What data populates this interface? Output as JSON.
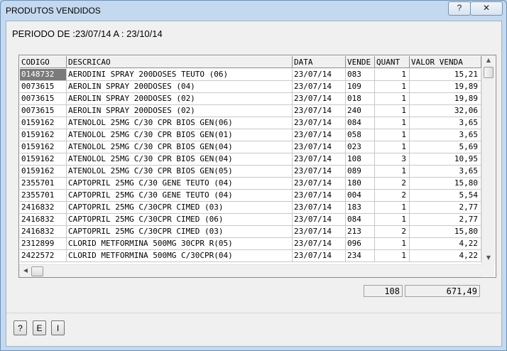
{
  "window": {
    "title": "PRODUTOS VENDIDOS",
    "help_label": "?",
    "close_label": "✕"
  },
  "period": {
    "text": "PERIODO DE :23/07/14 A : 23/10/14"
  },
  "table": {
    "columns": [
      "CODIGO",
      "DESCRICAO",
      "DATA",
      "VENDE",
      "QUANT",
      "VALOR VENDA"
    ],
    "rows": [
      [
        "0148732",
        "AERODINI SPRAY 200DOSES TEUTO   (06)",
        "23/07/14",
        "083",
        "1",
        "15,21"
      ],
      [
        "0073615",
        "AEROLIN SPRAY 200DOSES          (04)",
        "23/07/14",
        "109",
        "1",
        "19,89"
      ],
      [
        "0073615",
        "AEROLIN SPRAY 200DOSES          (02)",
        "23/07/14",
        "018",
        "1",
        "19,89"
      ],
      [
        "0073615",
        "AEROLIN SPRAY 200DOSES          (02)",
        "23/07/14",
        "240",
        "1",
        "32,06"
      ],
      [
        "0159162",
        "ATENOLOL 25MG C/30 CPR BIOS GEN(06)",
        "23/07/14",
        "084",
        "1",
        "3,65"
      ],
      [
        "0159162",
        "ATENOLOL 25MG C/30 CPR BIOS GEN(01)",
        "23/07/14",
        "058",
        "1",
        "3,65"
      ],
      [
        "0159162",
        "ATENOLOL 25MG C/30 CPR BIOS GEN(04)",
        "23/07/14",
        "023",
        "1",
        "5,69"
      ],
      [
        "0159162",
        "ATENOLOL 25MG C/30 CPR BIOS GEN(04)",
        "23/07/14",
        "108",
        "3",
        "10,95"
      ],
      [
        "0159162",
        "ATENOLOL 25MG C/30 CPR BIOS GEN(05)",
        "23/07/14",
        "089",
        "1",
        "3,65"
      ],
      [
        "2355701",
        "CAPTOPRIL 25MG C/30 GENE TEUTO (04)",
        "23/07/14",
        "180",
        "2",
        "15,80"
      ],
      [
        "2355701",
        "CAPTOPRIL 25MG C/30 GENE TEUTO (04)",
        "23/07/14",
        "004",
        "2",
        "5,54"
      ],
      [
        "2416832",
        "CAPTOPRIL 25MG C/30CPR CIMED   (03)",
        "23/07/14",
        "183",
        "1",
        "2,77"
      ],
      [
        "2416832",
        "CAPTOPRIL 25MG C/30CPR CIMED   (06)",
        "23/07/14",
        "084",
        "1",
        "2,77"
      ],
      [
        "2416832",
        "CAPTOPRIL 25MG C/30CPR CIMED   (03)",
        "23/07/14",
        "213",
        "2",
        "15,80"
      ],
      [
        "2312899",
        "CLORID METFORMINA 500MG 30CPR R(05)",
        "23/07/14",
        "096",
        "1",
        "4,22"
      ],
      [
        "2422572",
        "CLORID METFORMINA 500MG C/30CPR(04)",
        "23/07/14",
        "234",
        "1",
        "4,22"
      ]
    ]
  },
  "totals": {
    "quantity": "108",
    "value": "671,49"
  },
  "buttons": {
    "help": "?",
    "e": "E",
    "i": "I"
  }
}
